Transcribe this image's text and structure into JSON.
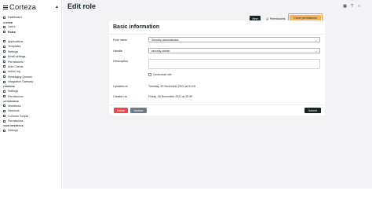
{
  "brand": {
    "name": "Corteza"
  },
  "page": {
    "title": "Edit role"
  },
  "sidebar": {
    "items": [
      {
        "type": "item",
        "label": "Dashboard"
      },
      {
        "type": "section",
        "label": "SYSTEM"
      },
      {
        "type": "item",
        "label": "Users"
      },
      {
        "type": "item",
        "label": "Roles",
        "active": true
      },
      {
        "type": "section",
        "label": ""
      },
      {
        "type": "item",
        "label": "Applications"
      },
      {
        "type": "item",
        "label": "Templates"
      },
      {
        "type": "item",
        "label": "Settings"
      },
      {
        "type": "item",
        "label": "Email settings"
      },
      {
        "type": "item",
        "label": "Permissions"
      },
      {
        "type": "item",
        "label": "Auth Clients"
      },
      {
        "type": "item",
        "label": "Action log"
      },
      {
        "type": "item",
        "label": "Messaging Queues"
      },
      {
        "type": "item",
        "label": "Integration Gateway"
      },
      {
        "type": "section",
        "label": "COMPOSE"
      },
      {
        "type": "item",
        "label": "Settings"
      },
      {
        "type": "item",
        "label": "Permissions"
      },
      {
        "type": "section",
        "label": "AUTOMATION"
      },
      {
        "type": "item",
        "label": "Workflows"
      },
      {
        "type": "item",
        "label": "Sessions"
      },
      {
        "type": "item",
        "label": "Corredor Scripts"
      },
      {
        "type": "item",
        "label": "Permissions"
      },
      {
        "type": "section",
        "label": "USER INTERFACE"
      },
      {
        "type": "item",
        "label": "Settings"
      }
    ]
  },
  "toolbar": {
    "new_label": "New",
    "permissions_label": "Permissions",
    "clone_label": "Clone permissions"
  },
  "form": {
    "section_title": "Basic information",
    "role_name_label": "Role name",
    "role_name_value": "Security administrator",
    "handle_label": "Handle",
    "handle_value": "security-admin",
    "description_label": "Description",
    "contextual_label": "Contextual role",
    "updated_label": "Updated at",
    "updated_value": "Tuesday, 30 November 2021 at 01:18",
    "created_label": "Created at",
    "created_value": "Friday, 26 November 2021 at 20:59"
  },
  "actions": {
    "delete_label": "Delete",
    "archive_label": "Archive",
    "submit_label": "Submit"
  },
  "colors": {
    "accent_dark": "#162425",
    "clone_highlight": "#f6a130",
    "delete": "#e54a4a",
    "archive": "#6f7a86",
    "valid_border": "#68d89b"
  }
}
